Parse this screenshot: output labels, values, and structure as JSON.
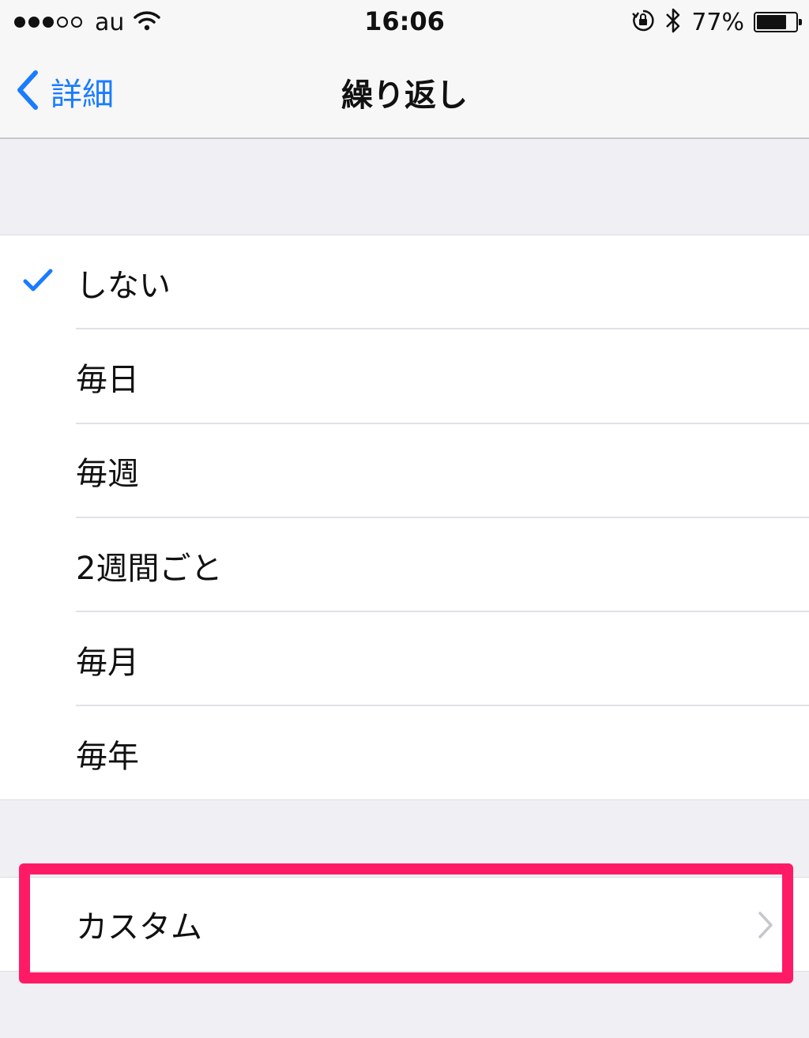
{
  "status_bar": {
    "signal_bars_filled": 3,
    "signal_bars_total": 5,
    "carrier": "au",
    "time": "16:06",
    "battery_percent": "77%",
    "battery_level": 0.77
  },
  "nav": {
    "back_label": "詳細",
    "title": "繰り返し"
  },
  "repeat_options": [
    {
      "label": "しない",
      "selected": true
    },
    {
      "label": "毎日",
      "selected": false
    },
    {
      "label": "毎週",
      "selected": false
    },
    {
      "label": "2週間ごと",
      "selected": false
    },
    {
      "label": "毎月",
      "selected": false
    },
    {
      "label": "毎年",
      "selected": false
    }
  ],
  "custom": {
    "label": "カスタム"
  },
  "colors": {
    "accent": "#1a7cff",
    "highlight": "#ff1a66",
    "background": "#efeff4"
  },
  "icons": [
    "wifi-icon",
    "orientation-lock-icon",
    "bluetooth-icon",
    "battery-icon",
    "back-chevron-icon",
    "checkmark-icon",
    "chevron-right-icon"
  ]
}
